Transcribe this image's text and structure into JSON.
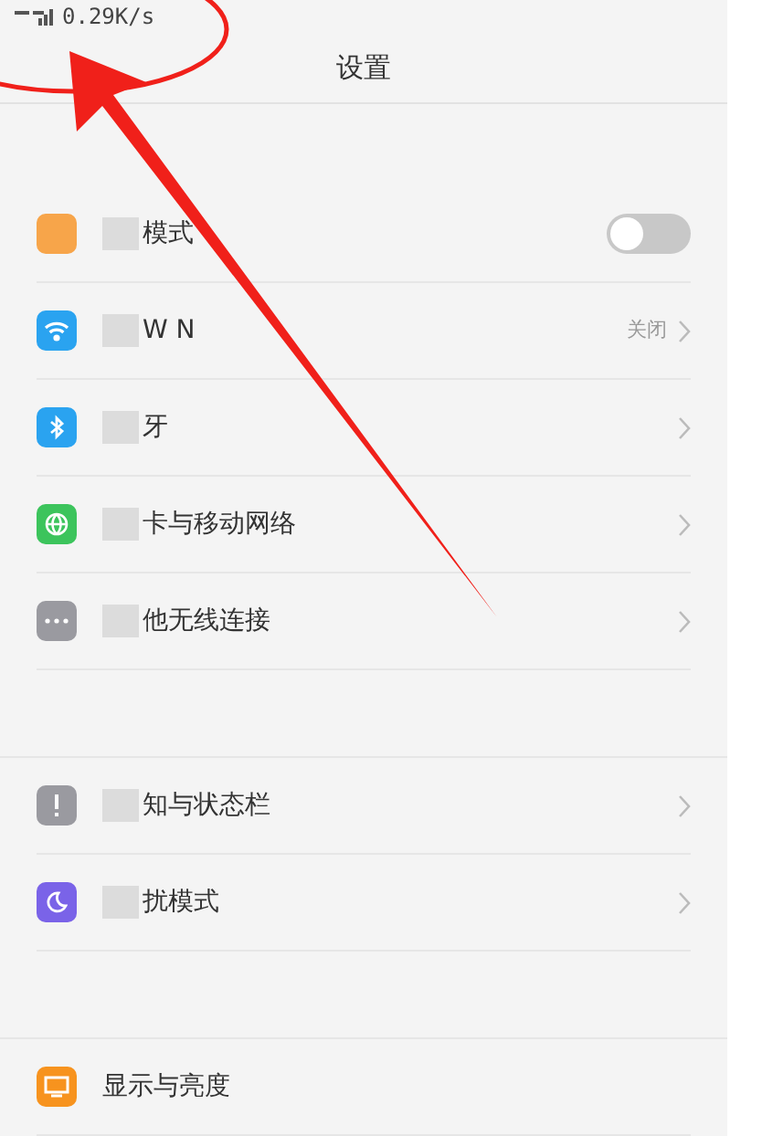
{
  "status_bar": {
    "speed": "0.29K/s"
  },
  "header": {
    "title": "设置"
  },
  "groups": [
    {
      "items": [
        {
          "kind": "toggle",
          "label": "模式",
          "censored": true,
          "on": false
        },
        {
          "kind": "link",
          "label": "W   N",
          "censored": true,
          "value": "关闭"
        },
        {
          "kind": "link",
          "label": "牙",
          "censored": true
        },
        {
          "kind": "link",
          "label": "卡与移动网络",
          "censored": true
        },
        {
          "kind": "link",
          "label": "他无线连接",
          "censored": true
        }
      ]
    },
    {
      "items": [
        {
          "kind": "link",
          "label": "知与状态栏",
          "censored": true
        },
        {
          "kind": "link",
          "label": "扰模式",
          "censored": true
        }
      ]
    },
    {
      "items": [
        {
          "kind": "plain",
          "label": "显示与亮度",
          "censored": false
        }
      ]
    }
  ]
}
